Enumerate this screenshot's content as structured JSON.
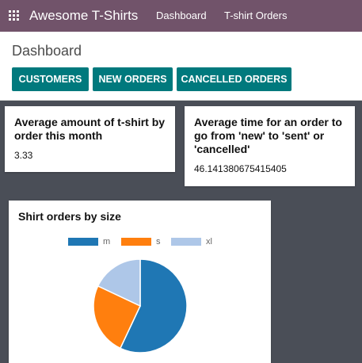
{
  "app": {
    "name": "Awesome T-Shirts"
  },
  "nav": {
    "items": [
      "Dashboard",
      "T-shirt Orders"
    ]
  },
  "page": {
    "title": "Dashboard"
  },
  "buttons": {
    "customers": "CUSTOMERS",
    "new_orders": "NEW ORDERS",
    "cancelled_orders": "CANCELLED ORDERS"
  },
  "cards": {
    "avg_tshirt": {
      "title_lines": [
        "Average amount of t-shirt by",
        "order this month"
      ],
      "value": "3.33"
    },
    "avg_time": {
      "title_lines": [
        "Average time for an order to",
        "go from 'new' to 'sent' or",
        "'cancelled'"
      ],
      "value": "46.141380675415405"
    }
  },
  "colors": {
    "navbar": "#71536a",
    "accent": "#00797d",
    "background": "#4a4e57"
  },
  "chart_data": {
    "type": "pie",
    "title": "Shirt orders by size",
    "labels": [
      "m",
      "s",
      "xl"
    ],
    "values": [
      57,
      25,
      18
    ],
    "colors": [
      "#1f77b4",
      "#ff7f0e",
      "#aec7e8"
    ],
    "legend": "top"
  }
}
